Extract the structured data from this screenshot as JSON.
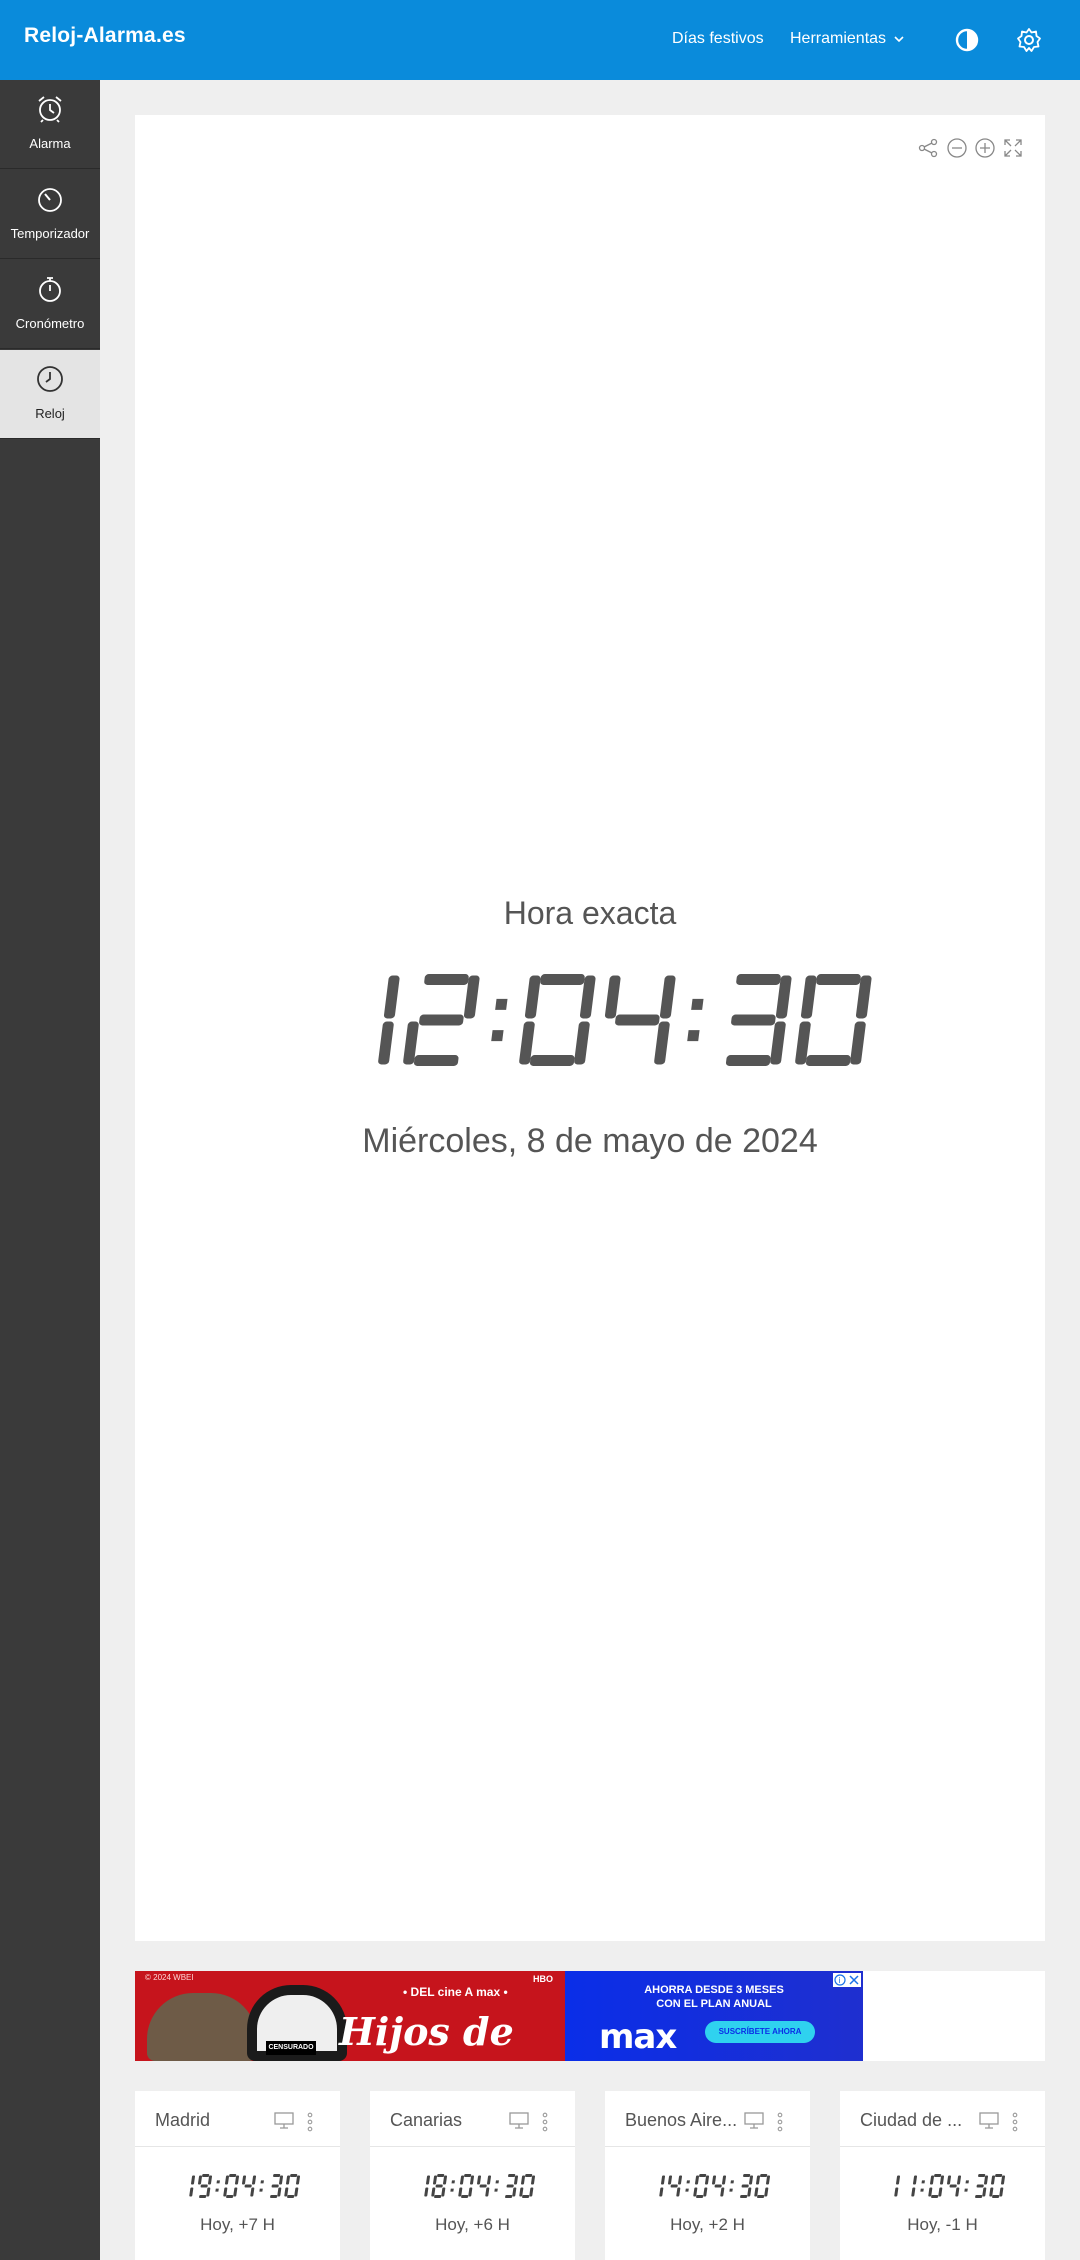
{
  "app": {
    "brand": "Reloj-Alarma.es",
    "nav": {
      "festivos": "Días festivos",
      "tools": "Herramientas"
    },
    "icons": {
      "contrast": "contrast-icon",
      "settings": "gear-icon"
    },
    "colors": {
      "accent": "#0a8bdb",
      "sidebar": "#3a3a3a",
      "sidebar_active": "#e4e4e4",
      "digits": "#555555"
    }
  },
  "sidebar": {
    "items": [
      {
        "label": "Alarma",
        "icon": "alarm-clock-icon",
        "active": false
      },
      {
        "label": "Temporizador",
        "icon": "timer-icon",
        "active": false
      },
      {
        "label": "Cronómetro",
        "icon": "stopwatch-icon",
        "active": false
      },
      {
        "label": "Reloj",
        "icon": "clock-icon",
        "active": true
      }
    ]
  },
  "clock": {
    "title": "Hora exacta",
    "time": "12:04:30",
    "date": "Miércoles, 8 de mayo de 2024",
    "tools": [
      "share-icon",
      "zoom-out-icon",
      "zoom-in-icon",
      "fullscreen-icon"
    ]
  },
  "ad": {
    "copyright": "© 2024 WBEI",
    "brand_line": "• DEL cine A max •",
    "hbo": "HBO",
    "censor": "CENSURADO",
    "title": "Hijos de perra",
    "offer_line1": "AHORRA DESDE 3 MESES",
    "offer_line2": "CON EL PLAN ANUAL",
    "logo": "max",
    "cta": "SUSCRÍBETE AHORA"
  },
  "cities": [
    {
      "name": "Madrid",
      "time": "19:04:30",
      "offset": "Hoy, +7 H"
    },
    {
      "name": "Canarias",
      "time": "18:04:30",
      "offset": "Hoy, +6 H"
    },
    {
      "name": "Buenos Aire...",
      "time": "14:04:30",
      "offset": "Hoy, +2 H"
    },
    {
      "name": "Ciudad de ...",
      "time": "11:04:30",
      "offset": "Hoy, -1 H"
    }
  ]
}
